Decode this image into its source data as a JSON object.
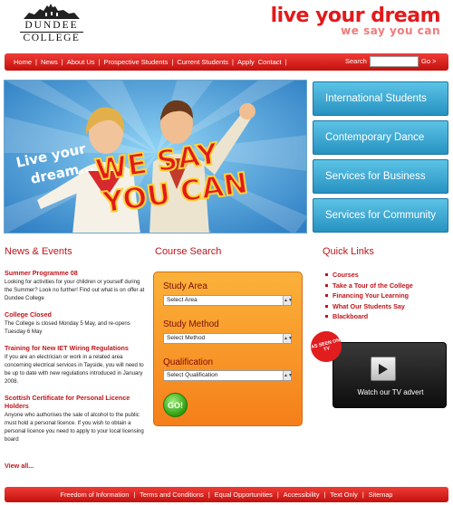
{
  "header": {
    "logo_line1": "DUNDEE",
    "logo_line2": "COLLEGE",
    "tagline_main": "live your dream",
    "tagline_sub": "we say you can"
  },
  "topnav": {
    "links": [
      "Home",
      "News",
      "About Us",
      "Prospective Students",
      "Current Students",
      "Apply",
      "Contact"
    ],
    "search_label": "Search",
    "search_value": "",
    "search_go": "Go >"
  },
  "hero": {
    "text_line1": "Live your",
    "text_line2": "dream...",
    "big_line1": "WE SAY",
    "big_line2": "YOU CAN"
  },
  "promos": [
    "International Students",
    "Contemporary Dance",
    "Services for Business",
    "Services for Community"
  ],
  "news": {
    "title": "News & Events",
    "items": [
      {
        "title": "Summer Programme 08",
        "body": "Looking for activities for your children or yourself during the Summer? Look no further! Find out what is on offer at Dundee College"
      },
      {
        "title": "College Closed",
        "body": "The College is closed Monday 5 May, and re-opens Tuesday 6 May"
      },
      {
        "title": "Training for New IET Wiring Regulations",
        "body": "If you are an electrician or work in a related area concerning electrical services in Tayside, you will need to be up to date with new regulations introduced in January 2008."
      },
      {
        "title": "Scottish Certificate for Personal Licence Holders",
        "body": "Anyone who authorises the sale of alcohol to the public must hold a personal licence. If you wish to obtain a personal licence you need to apply to your local licensing board"
      }
    ],
    "view_all": "View all..."
  },
  "course_search": {
    "title": "Course Search",
    "study_area_label": "Study Area",
    "study_area_value": "Select Area",
    "study_method_label": "Study Method",
    "study_method_value": "Select Method",
    "qualification_label": "Qualification",
    "qualification_value": "Select Qualification",
    "go_label": "GO!"
  },
  "quick_links": {
    "title": "Quick Links",
    "items": [
      "Courses",
      "Take a Tour of the College",
      "Financing Your Learning",
      "What Our Students Say",
      "Blackboard"
    ]
  },
  "tv": {
    "badge": "AS SEEN ON TV",
    "label": "Watch our TV advert"
  },
  "footer": {
    "links": [
      "Freedom of Information",
      "Terms and Conditions",
      "Equal Opportunities",
      "Accessibility",
      "Text Only",
      "Sitemap"
    ]
  },
  "colors": {
    "brand_red": "#e3191b",
    "promo_blue": "#2792c2",
    "course_orange": "#f57f1a"
  }
}
